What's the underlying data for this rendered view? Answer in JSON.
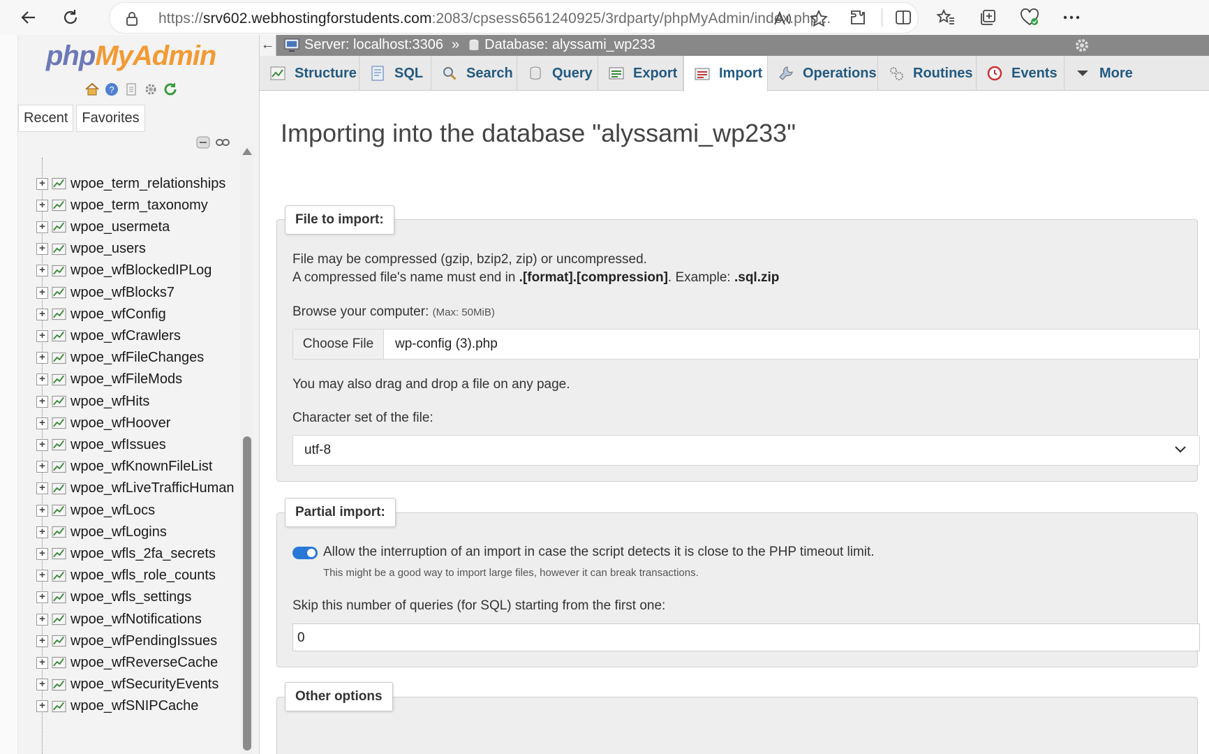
{
  "browser": {
    "url_prefix": "https://",
    "url_host": "srv602.webhostingforstudents.com",
    "url_rest": ":2083/cpsess6561240925/3rdparty/phpMyAdmin/index.php..."
  },
  "sidebar": {
    "logo_php": "php",
    "logo_myadmin": "MyAdmin",
    "tabs": [
      "Recent",
      "Favorites"
    ],
    "tables": [
      "wpoe_term_relationships",
      "wpoe_term_taxonomy",
      "wpoe_usermeta",
      "wpoe_users",
      "wpoe_wfBlockedIPLog",
      "wpoe_wfBlocks7",
      "wpoe_wfConfig",
      "wpoe_wfCrawlers",
      "wpoe_wfFileChanges",
      "wpoe_wfFileMods",
      "wpoe_wfHits",
      "wpoe_wfHoover",
      "wpoe_wfIssues",
      "wpoe_wfKnownFileList",
      "wpoe_wfLiveTrafficHuman",
      "wpoe_wfLocs",
      "wpoe_wfLogins",
      "wpoe_wfls_2fa_secrets",
      "wpoe_wfls_role_counts",
      "wpoe_wfls_settings",
      "wpoe_wfNotifications",
      "wpoe_wfPendingIssues",
      "wpoe_wfReverseCache",
      "wpoe_wfSecurityEvents",
      "wpoe_wfSNIPCache"
    ]
  },
  "breadcrumb": {
    "server": "Server: localhost:3306",
    "separator": "»",
    "database": "Database: alyssami_wp233"
  },
  "tabs": [
    "Structure",
    "SQL",
    "Search",
    "Query",
    "Export",
    "Import",
    "Operations",
    "Routines",
    "Events",
    "More"
  ],
  "active_tab": "Import",
  "page": {
    "title": "Importing into the database \"alyssami_wp233\"",
    "file_section": {
      "legend": "File to import:",
      "line1": "File may be compressed (gzip, bzip2, zip) or uncompressed.",
      "line2_a": "A compressed file's name must end in ",
      "line2_b": ".[format].[compression]",
      "line2_c": ". Example: ",
      "line2_d": ".sql.zip",
      "browse_label": "Browse your computer:",
      "browse_max": "(Max: 50MiB)",
      "choose_file": "Choose File",
      "file_name": "wp-config (3).php",
      "drag_note": "You may also drag and drop a file on any page.",
      "charset_label": "Character set of the file:",
      "charset_value": "utf-8"
    },
    "partial_section": {
      "legend": "Partial import:",
      "allow_interrupt": "Allow the interruption of an import in case the script detects it is close to the PHP timeout limit.",
      "allow_note": "This might be a good way to import large files, however it can break transactions.",
      "skip_label": "Skip this number of queries (for SQL) starting from the first one:",
      "skip_value": "0"
    },
    "other_section": {
      "legend": "Other options"
    }
  },
  "colors": {
    "tab_text": "#235a81",
    "toggle_on": "#2878d7",
    "topbar": "#888888"
  }
}
